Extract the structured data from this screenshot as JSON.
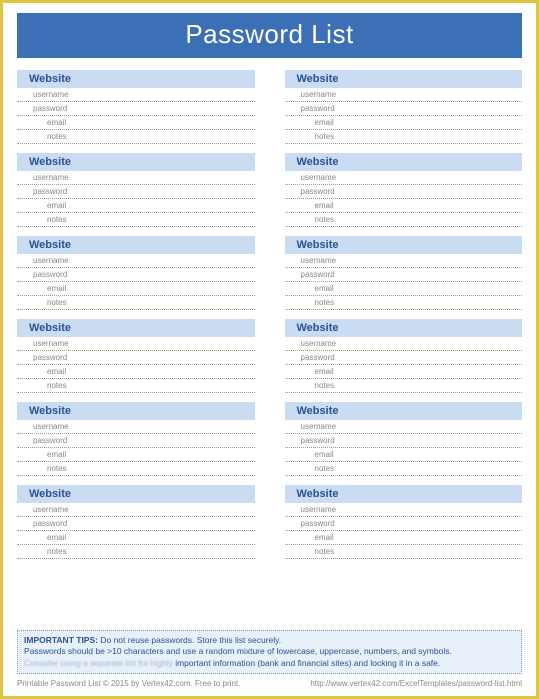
{
  "title": "Password List",
  "block_header": "Website",
  "fields": {
    "username": "username",
    "password": "password",
    "email": "email",
    "notes": "notes"
  },
  "blocks_per_column": 6,
  "tips": {
    "lead": "IMPORTANT TIPS:",
    "line1_rest": " Do not reuse passwords. Store this list securely.",
    "line2": "Passwords should be >10 characters and use a random mixture of lowercase, uppercase, numbers, and symbols.",
    "line3_blur": "Consider using a separate list for highly ",
    "line3_rest": "important information (bank and financial sites) and locking it in a safe."
  },
  "footer": {
    "left": "Printable Password List © 2015 by Vertex42.com. Free to print.",
    "right": "http://www.vertex42.com/ExcelTemplates/password-list.html"
  }
}
